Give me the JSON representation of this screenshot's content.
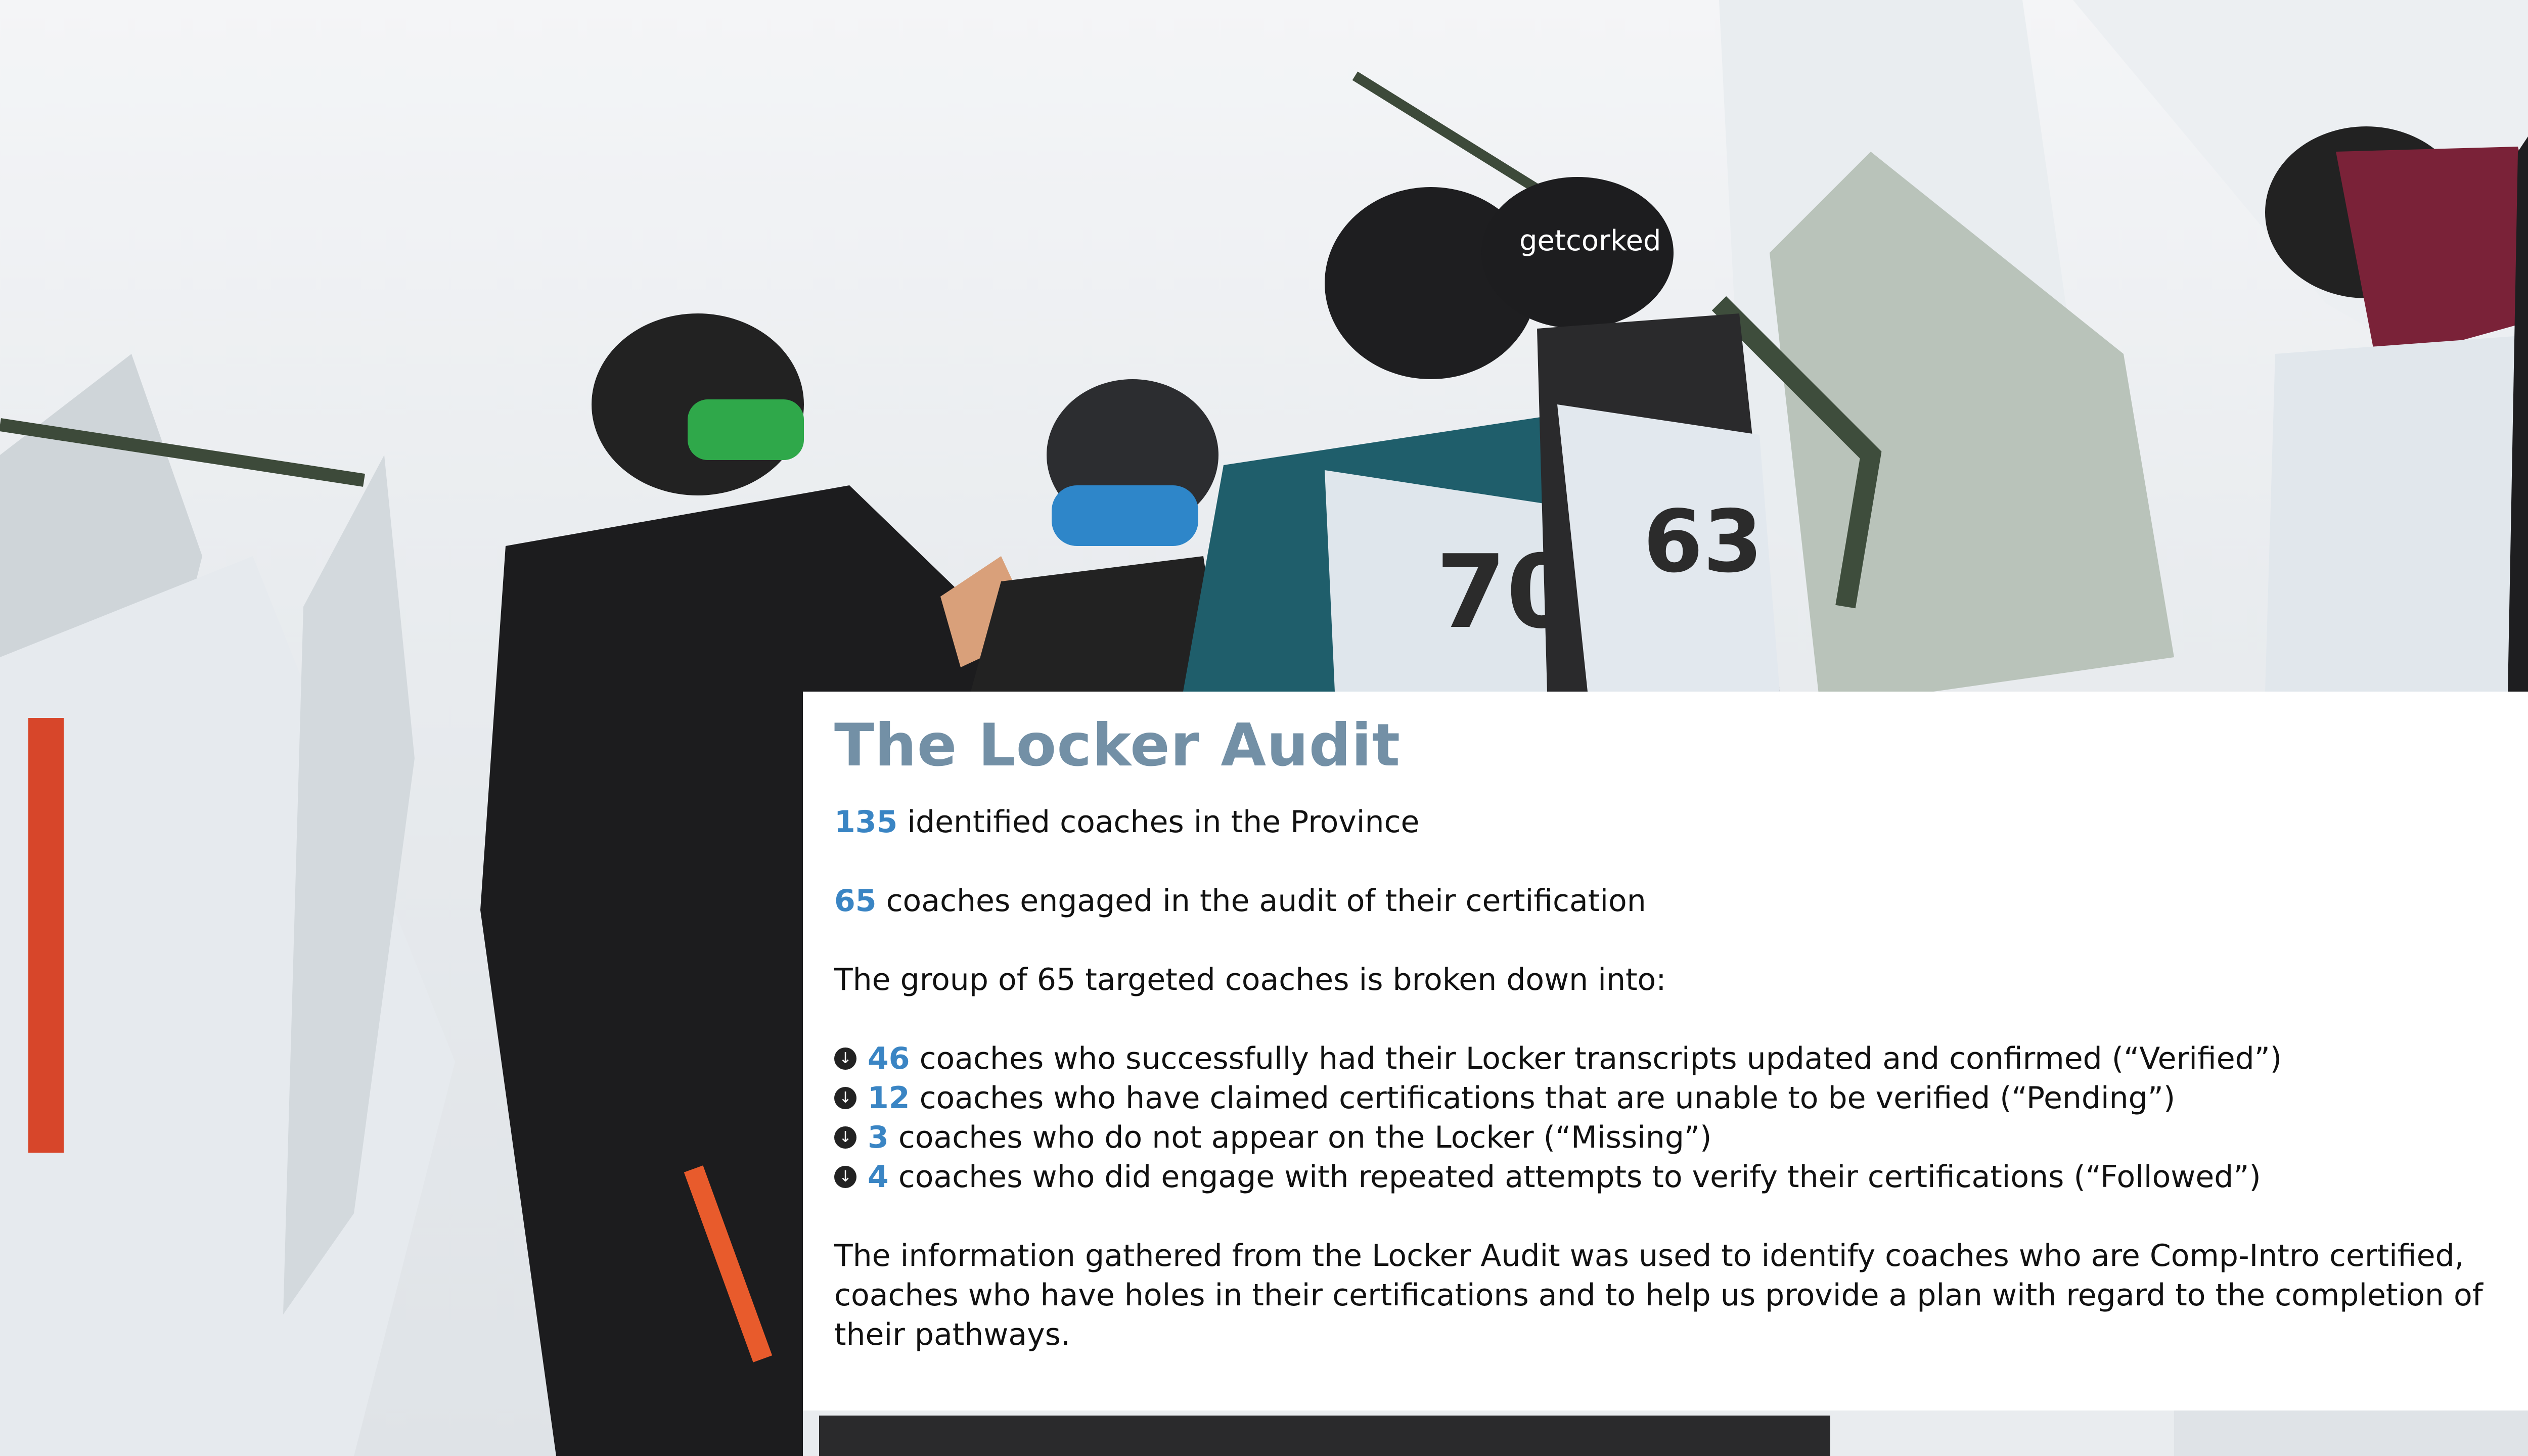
{
  "page": {
    "title": "The Locker Audit",
    "stats": [
      {
        "num": "135",
        "text": " identified coaches in the Province"
      },
      {
        "num": "65",
        "text": " coaches engaged in the audit of their certification"
      }
    ],
    "breakdown_intro": "The group of 65 targeted coaches is broken down into:",
    "bullets": [
      {
        "num": "46",
        "text": " coaches who successfully had their Locker transcripts updated and confirmed (“Verified”)"
      },
      {
        "num": "12",
        "text": " coaches who have claimed certifications that are unable to be verified (“Pending”)"
      },
      {
        "num": "3",
        "text": " coaches who do not appear on the Locker (“Missing”)"
      },
      {
        "num": "4",
        "text": " coaches who did engage with repeated attempts to verify their certifications (“Followed”)"
      }
    ],
    "bullet_icon": "arrow-circle-icon",
    "conclusion": "The information gathered from the Locker Audit was used to identify coaches who are Comp-Intro certified, coaches who have holes in their certifications and to help us provide a plan with regard to the completion of their pathways."
  },
  "photo": {
    "description_icon": "snow-scene-photo",
    "helmet_text": "getcorked",
    "bib_numbers": [
      "70",
      "63"
    ]
  },
  "colors": {
    "title": "#7390a6",
    "number_accent": "#3a85c4",
    "body_text": "#111111",
    "card_bg": "#ffffff"
  }
}
